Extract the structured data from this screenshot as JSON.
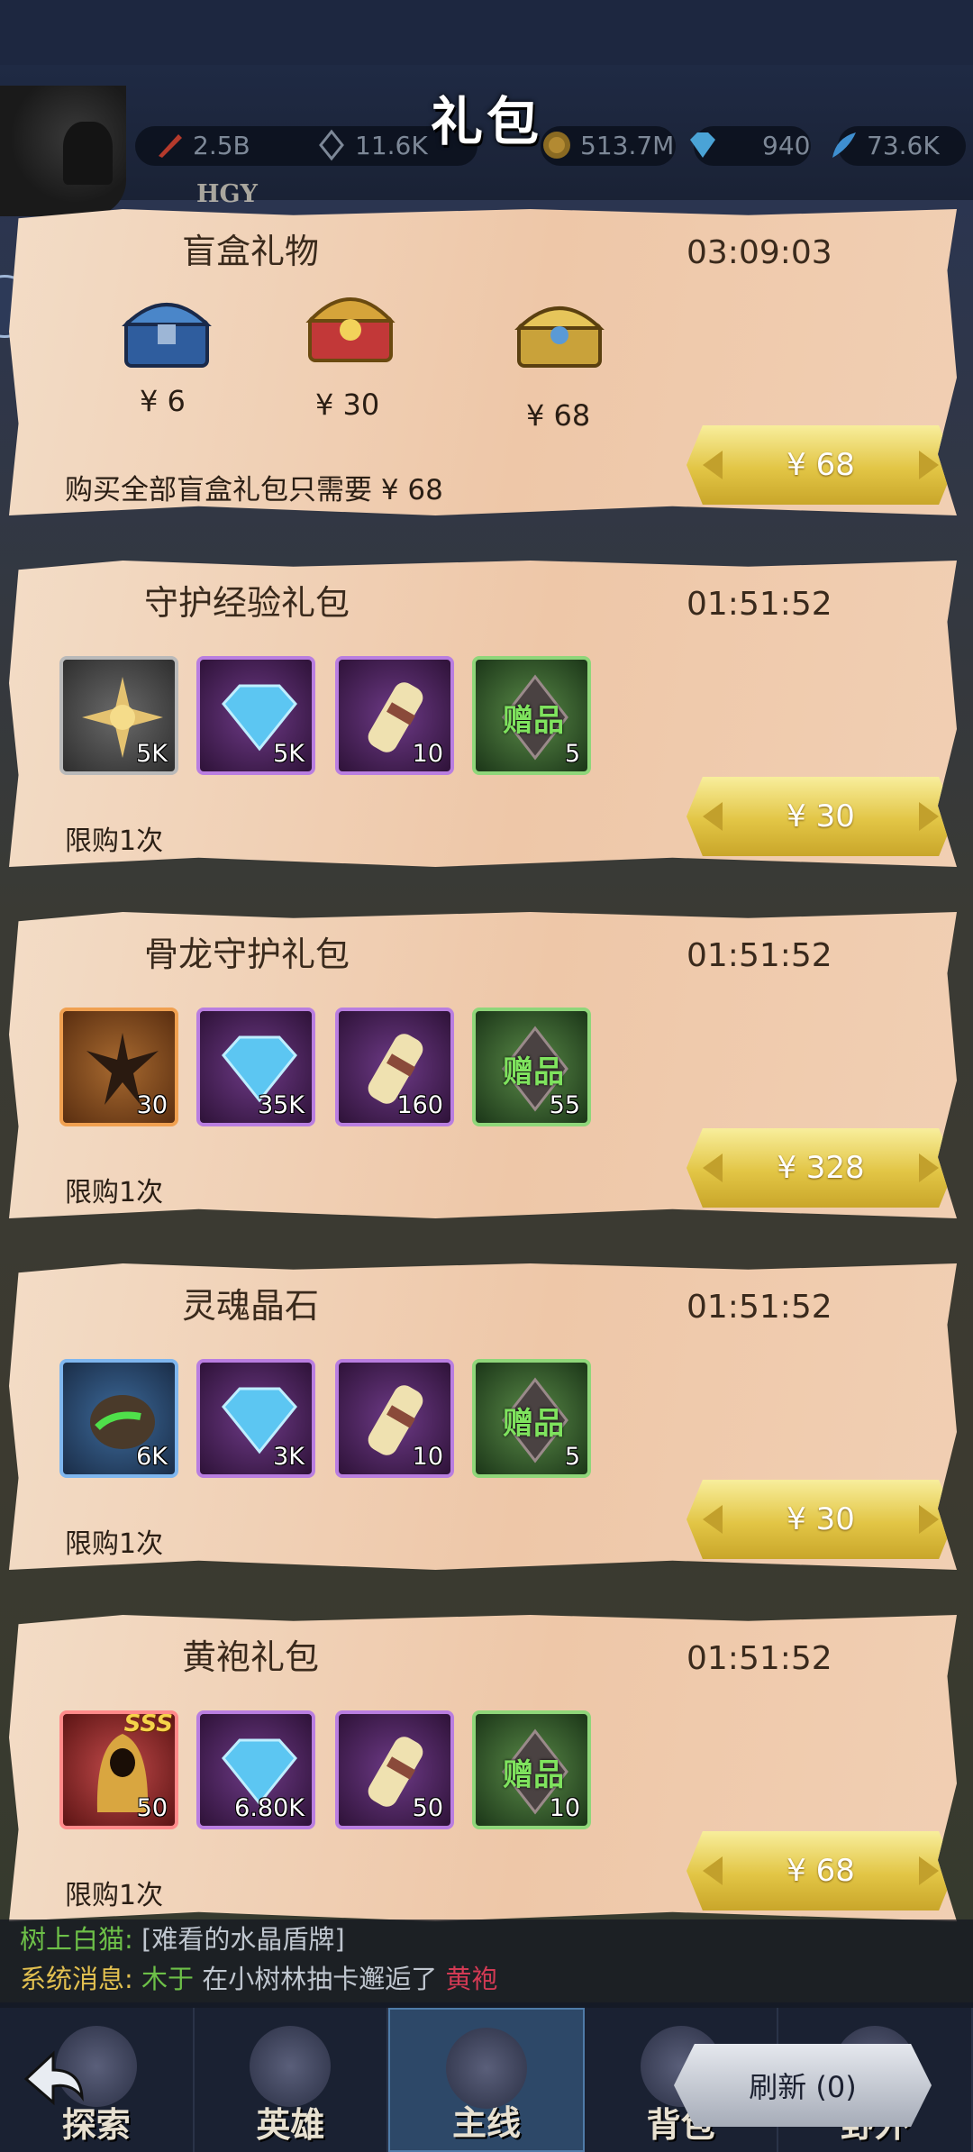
{
  "header": {
    "title": "礼包",
    "player_name": "HGY",
    "resources": [
      {
        "icon": "attack-power-icon",
        "value": "2.5B"
      },
      {
        "icon": "crystal-icon",
        "value": "11.6K"
      },
      {
        "icon": "gold-coin-icon",
        "value": "513.7M"
      },
      {
        "icon": "diamond-icon",
        "value": "940"
      },
      {
        "icon": "feather-icon",
        "value": "73.6K"
      }
    ]
  },
  "packs": [
    {
      "title": "盲盒礼物",
      "timer": "03:09:03",
      "chests": [
        {
          "icon": "blue-chest-icon",
          "price": "¥ 6"
        },
        {
          "icon": "red-chest-icon",
          "price": "¥ 30"
        },
        {
          "icon": "gold-chest-icon",
          "price": "¥ 68"
        }
      ],
      "note": "购买全部盲盒礼包只需要 ¥ 68",
      "buy_label": "¥ 68"
    },
    {
      "title": "守护经验礼包",
      "timer": "01:51:52",
      "items": [
        {
          "icon": "sun-star-icon",
          "qty": "5K",
          "rarity": "gray"
        },
        {
          "icon": "diamond-icon",
          "qty": "5K",
          "rarity": "purple"
        },
        {
          "icon": "scroll-icon",
          "qty": "10",
          "rarity": "purple"
        },
        {
          "icon": "gift-crystal-icon",
          "qty": "5",
          "rarity": "green",
          "label": "赠品"
        }
      ],
      "limit": "限购1次",
      "buy_label": "¥ 30"
    },
    {
      "title": "骨龙守护礼包",
      "timer": "01:51:52",
      "items": [
        {
          "icon": "bone-dragon-icon",
          "qty": "30",
          "rarity": "orange"
        },
        {
          "icon": "diamond-icon",
          "qty": "35K",
          "rarity": "purple"
        },
        {
          "icon": "scroll-icon",
          "qty": "160",
          "rarity": "purple"
        },
        {
          "icon": "gift-crystal-icon",
          "qty": "55",
          "rarity": "green",
          "label": "赠品"
        }
      ],
      "limit": "限购1次",
      "buy_label": "¥ 328"
    },
    {
      "title": "灵魂晶石",
      "timer": "01:51:52",
      "items": [
        {
          "icon": "soul-stone-icon",
          "qty": "6K",
          "rarity": "blue"
        },
        {
          "icon": "diamond-icon",
          "qty": "3K",
          "rarity": "purple"
        },
        {
          "icon": "scroll-icon",
          "qty": "10",
          "rarity": "purple"
        },
        {
          "icon": "gift-crystal-icon",
          "qty": "5",
          "rarity": "green",
          "label": "赠品"
        }
      ],
      "limit": "限购1次",
      "buy_label": "¥ 30"
    },
    {
      "title": "黄袍礼包",
      "timer": "01:51:52",
      "items": [
        {
          "icon": "yellow-robe-hero-icon",
          "qty": "50",
          "rarity": "red",
          "badge": "SSS"
        },
        {
          "icon": "diamond-icon",
          "qty": "6.80K",
          "rarity": "purple"
        },
        {
          "icon": "scroll-icon",
          "qty": "50",
          "rarity": "purple"
        },
        {
          "icon": "gift-crystal-icon",
          "qty": "10",
          "rarity": "green",
          "label": "赠品"
        }
      ],
      "limit": "限购1次",
      "buy_label": "¥ 68"
    }
  ],
  "chat": {
    "line1_name": "树上白猫:",
    "line1_text": "[难看的水晶盾牌]",
    "line2_prefix": "系统消息:",
    "line2_user": "木于",
    "line2_mid": "在小树林抽卡邂逅了",
    "line2_item": "黄袍"
  },
  "nav": {
    "tabs": [
      "探索",
      "英雄",
      "主线",
      "背包",
      "野外"
    ],
    "active": "主线",
    "refresh_label": "刷新 (0)"
  },
  "colors": {
    "panel": "#f0cdb0",
    "buy_gold": "#e2c545",
    "chat_green": "#6dc048",
    "chat_red": "#d23a54",
    "nav_active": "#2d4868"
  }
}
